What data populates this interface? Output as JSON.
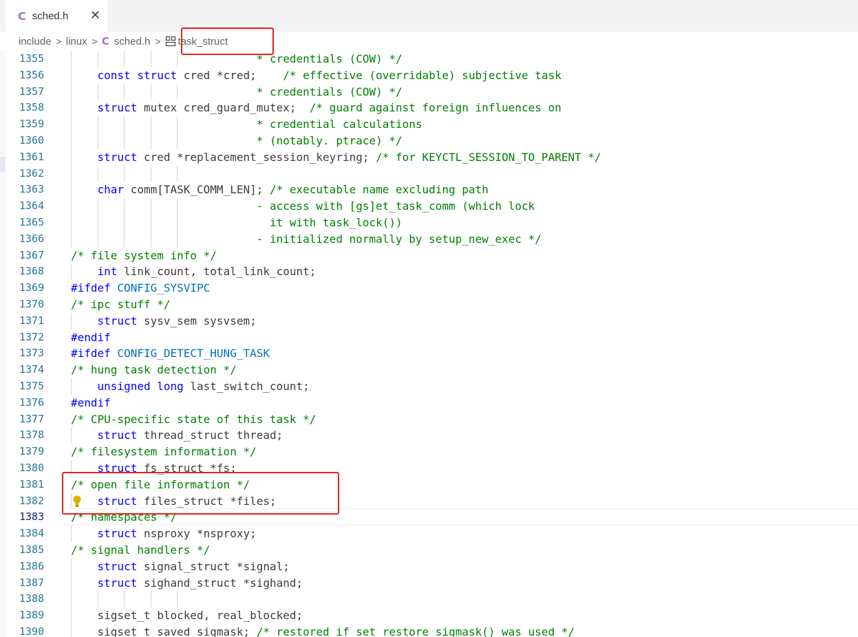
{
  "tab": {
    "icon": "C",
    "label": "sched.h",
    "close": "✕"
  },
  "breadcrumb": {
    "items": [
      "include",
      "linux",
      "sched.h",
      "task_struct"
    ],
    "file_icon": "C",
    "separator": ">"
  },
  "icons": {
    "tab_file": "c-file-icon",
    "struct": "struct-icon",
    "bulb": "lightbulb-icon"
  },
  "editor": {
    "lines": [
      {
        "n": "1355",
        "t": "                            * credentials (COW) */"
      },
      {
        "n": "1356",
        "t": "    const struct cred *cred;    /* effective (overridable) subjective task"
      },
      {
        "n": "1357",
        "t": "                            * credentials (COW) */"
      },
      {
        "n": "1358",
        "t": "    struct mutex cred_guard_mutex;  /* guard against foreign influences on"
      },
      {
        "n": "1359",
        "t": "                            * credential calculations"
      },
      {
        "n": "1360",
        "t": "                            * (notably. ptrace) */"
      },
      {
        "n": "1361",
        "t": "    struct cred *replacement_session_keyring; /* for KEYCTL_SESSION_TO_PARENT */"
      },
      {
        "n": "1362",
        "t": ""
      },
      {
        "n": "1363",
        "t": "    char comm[TASK_COMM_LEN]; /* executable name excluding path"
      },
      {
        "n": "1364",
        "t": "                            - access with [gs]et_task_comm (which lock"
      },
      {
        "n": "1365",
        "t": "                              it with task_lock())"
      },
      {
        "n": "1366",
        "t": "                            - initialized normally by setup_new_exec */"
      },
      {
        "n": "1367",
        "t": "/* file system info */"
      },
      {
        "n": "1368",
        "t": "    int link_count, total_link_count;"
      },
      {
        "n": "1369",
        "t": "#ifdef CONFIG_SYSVIPC"
      },
      {
        "n": "1370",
        "t": "/* ipc stuff */"
      },
      {
        "n": "1371",
        "t": "    struct sysv_sem sysvsem;"
      },
      {
        "n": "1372",
        "t": "#endif"
      },
      {
        "n": "1373",
        "t": "#ifdef CONFIG_DETECT_HUNG_TASK"
      },
      {
        "n": "1374",
        "t": "/* hung task detection */"
      },
      {
        "n": "1375",
        "t": "    unsigned long last_switch_count;"
      },
      {
        "n": "1376",
        "t": "#endif"
      },
      {
        "n": "1377",
        "t": "/* CPU-specific state of this task */"
      },
      {
        "n": "1378",
        "t": "    struct thread_struct thread;"
      },
      {
        "n": "1379",
        "t": "/* filesystem information */"
      },
      {
        "n": "1380",
        "t": "    struct fs_struct *fs;"
      },
      {
        "n": "1381",
        "t": "/* open file information */"
      },
      {
        "n": "1382",
        "t": "    struct files_struct *files;"
      },
      {
        "n": "1383",
        "t": "/* namespaces */"
      },
      {
        "n": "1384",
        "t": "    struct nsproxy *nsproxy;"
      },
      {
        "n": "1385",
        "t": "/* signal handlers */"
      },
      {
        "n": "1386",
        "t": "    struct signal_struct *signal;"
      },
      {
        "n": "1387",
        "t": "    struct sighand_struct *sighand;"
      },
      {
        "n": "1388",
        "t": ""
      },
      {
        "n": "1389",
        "t": "    sigset_t blocked, real_blocked;"
      },
      {
        "n": "1390",
        "t": "    sigset_t saved_sigmask; /* restored if set_restore_sigmask() was used */"
      }
    ],
    "active_line": "1383"
  },
  "colors": {
    "keyword": "#0000ff",
    "comment": "#008000",
    "line_number": "#237893",
    "highlight_box": "#e8201c"
  }
}
